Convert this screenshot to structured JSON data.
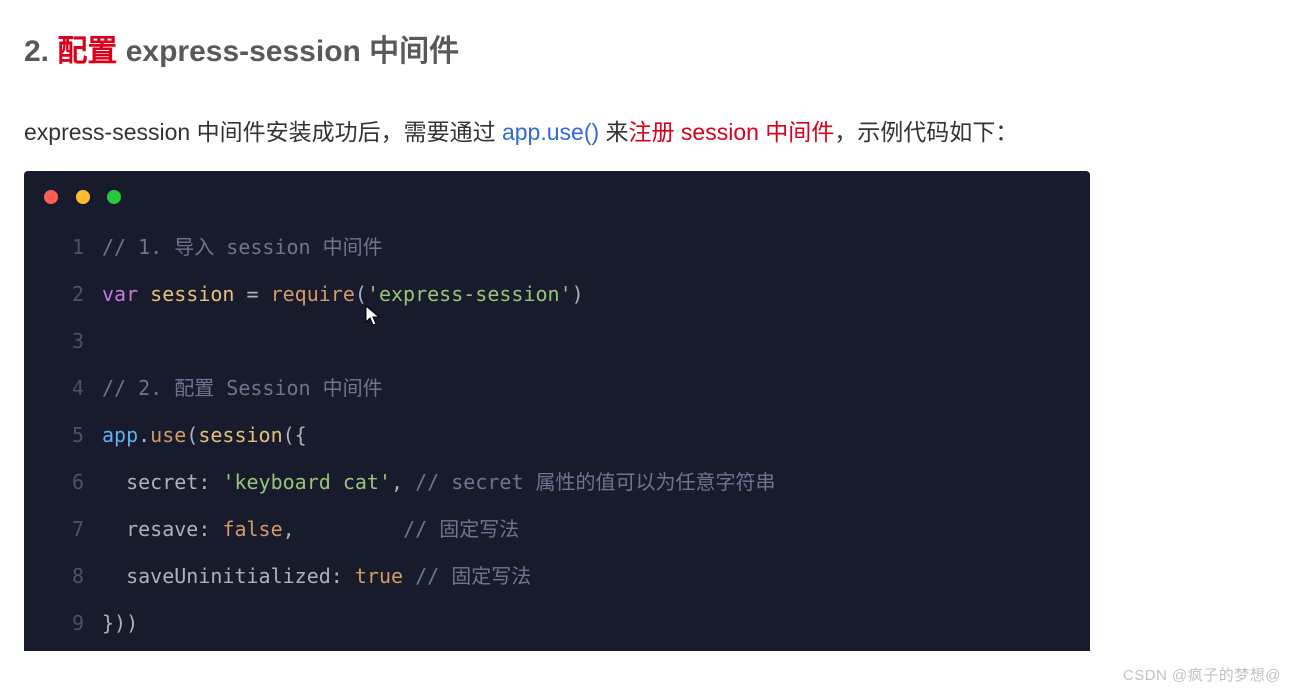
{
  "heading": {
    "number": "2.",
    "emphasis": "配置",
    "rest": " express-session 中间件"
  },
  "intro": {
    "t1": "express-session 中间件安装成功后，需要通过 ",
    "blue": "app.use()",
    "t2": " 来",
    "red": "注册 session 中间件",
    "t3": "，示例代码如下：",
    "full": "express-session 中间件安装成功后，需要通过 app.use() 来注册 session 中间件，示例代码如下："
  },
  "window": {
    "dot_red": "#ff5f56",
    "dot_yellow": "#ffbd2e",
    "dot_green": "#27c93f"
  },
  "code": {
    "lines": [
      {
        "n": 1,
        "tokens": [
          [
            "comment",
            "// 1. 导入 session 中间件"
          ]
        ]
      },
      {
        "n": 2,
        "tokens": [
          [
            "key",
            "var"
          ],
          [
            "punct",
            " "
          ],
          [
            "ident",
            "session"
          ],
          [
            "punct",
            " = "
          ],
          [
            "func",
            "require"
          ],
          [
            "punct",
            "("
          ],
          [
            "str",
            "'express-session'"
          ],
          [
            "punct",
            ")"
          ]
        ]
      },
      {
        "n": 3,
        "tokens": [
          [
            "punct",
            ""
          ]
        ]
      },
      {
        "n": 4,
        "tokens": [
          [
            "comment",
            "// 2. 配置 Session 中间件"
          ]
        ]
      },
      {
        "n": 5,
        "tokens": [
          [
            "obj",
            "app"
          ],
          [
            "punct",
            "."
          ],
          [
            "func",
            "use"
          ],
          [
            "punct",
            "("
          ],
          [
            "ident",
            "session"
          ],
          [
            "punct",
            "({"
          ]
        ]
      },
      {
        "n": 6,
        "tokens": [
          [
            "punct",
            "  "
          ],
          [
            "prop",
            "secret"
          ],
          [
            "punct",
            ": "
          ],
          [
            "str",
            "'keyboard cat'"
          ],
          [
            "punct",
            ", "
          ],
          [
            "comment",
            "// secret 属性的值可以为任意字符串"
          ]
        ]
      },
      {
        "n": 7,
        "tokens": [
          [
            "punct",
            "  "
          ],
          [
            "prop",
            "resave"
          ],
          [
            "punct",
            ": "
          ],
          [
            "bool",
            "false"
          ],
          [
            "punct",
            ",         "
          ],
          [
            "comment",
            "// 固定写法"
          ]
        ]
      },
      {
        "n": 8,
        "tokens": [
          [
            "punct",
            "  "
          ],
          [
            "prop",
            "saveUninitialized"
          ],
          [
            "punct",
            ": "
          ],
          [
            "bool",
            "true"
          ],
          [
            "punct",
            " "
          ],
          [
            "comment",
            "// 固定写法"
          ]
        ]
      },
      {
        "n": 9,
        "tokens": [
          [
            "punct",
            "}))"
          ]
        ]
      }
    ],
    "cursor_line": 2,
    "cursor_after_token_index": 5,
    "plain": "// 1. 导入 session 中间件\nvar session = require('express-session')\n\n// 2. 配置 Session 中间件\napp.use(session({\n  secret: 'keyboard cat', // secret 属性的值可以为任意字符串\n  resave: false,         // 固定写法\n  saveUninitialized: true // 固定写法\n}))"
  },
  "watermark": "CSDN @疯子的梦想@"
}
